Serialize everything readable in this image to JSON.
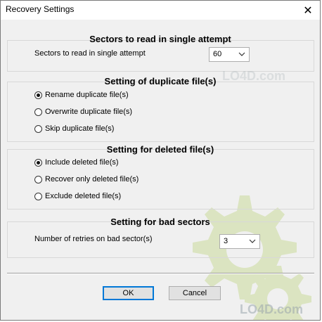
{
  "window": {
    "title": "Recovery Settings",
    "close_glyph": "✕"
  },
  "sectors": {
    "heading": "Sectors to read in single attempt",
    "label": "Sectors to read in single attempt",
    "value": "60"
  },
  "duplicate": {
    "heading": "Setting of duplicate file(s)",
    "options": [
      {
        "label": "Rename duplicate file(s)",
        "checked": true
      },
      {
        "label": "Overwrite duplicate file(s)",
        "checked": false
      },
      {
        "label": "Skip duplicate file(s)",
        "checked": false
      }
    ]
  },
  "deleted": {
    "heading": "Setting for deleted file(s)",
    "options": [
      {
        "label": "Include deleted file(s)",
        "checked": true
      },
      {
        "label": "Recover only deleted file(s)",
        "checked": false
      },
      {
        "label": "Exclude deleted file(s)",
        "checked": false
      }
    ]
  },
  "bad": {
    "heading": "Setting for bad sectors",
    "label": "Number of retries on bad sector(s)",
    "value": "3"
  },
  "buttons": {
    "ok": "OK",
    "cancel": "Cancel"
  },
  "watermarks": {
    "mid": "LO4D.com",
    "bottom": "LO4D.com"
  },
  "colors": {
    "watermark_green": "#b5cf6b"
  }
}
